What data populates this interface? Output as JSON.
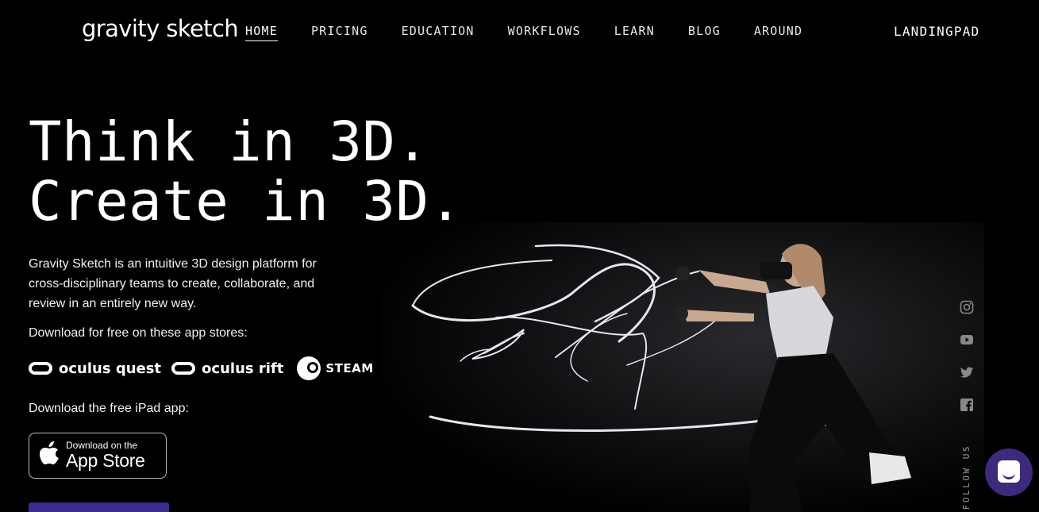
{
  "header": {
    "logo": "gravity sketch",
    "nav": [
      {
        "label": "HOME",
        "active": true
      },
      {
        "label": "PRICING",
        "active": false
      },
      {
        "label": "EDUCATION",
        "active": false
      },
      {
        "label": "WORKFLOWS",
        "active": false
      },
      {
        "label": "LEARN",
        "active": false
      },
      {
        "label": "BLOG",
        "active": false
      },
      {
        "label": "AROUND",
        "active": false
      }
    ],
    "landingpad": "LANDINGPAD"
  },
  "hero": {
    "headline_line1": "Think in 3D.",
    "headline_line2": "Create in 3D.",
    "description": "Gravity Sketch is an intuitive 3D design platform for cross-disciplinary teams to create, collaborate, and review in an entirely new way.",
    "download_text": "Download for free on these app stores:",
    "stores": {
      "quest": "oculus quest",
      "rift": "oculus rift",
      "steam": "STEAM"
    },
    "ipad_text": "Download the free iPad app:",
    "appstore_small": "Download on the",
    "appstore_big": "App Store"
  },
  "social": {
    "follow": "FOLLOW US",
    "icons": [
      "instagram-icon",
      "youtube-icon",
      "twitter-icon",
      "facebook-icon"
    ]
  },
  "colors": {
    "accent": "#3d2a8e",
    "chat": "#3d2a7e"
  }
}
